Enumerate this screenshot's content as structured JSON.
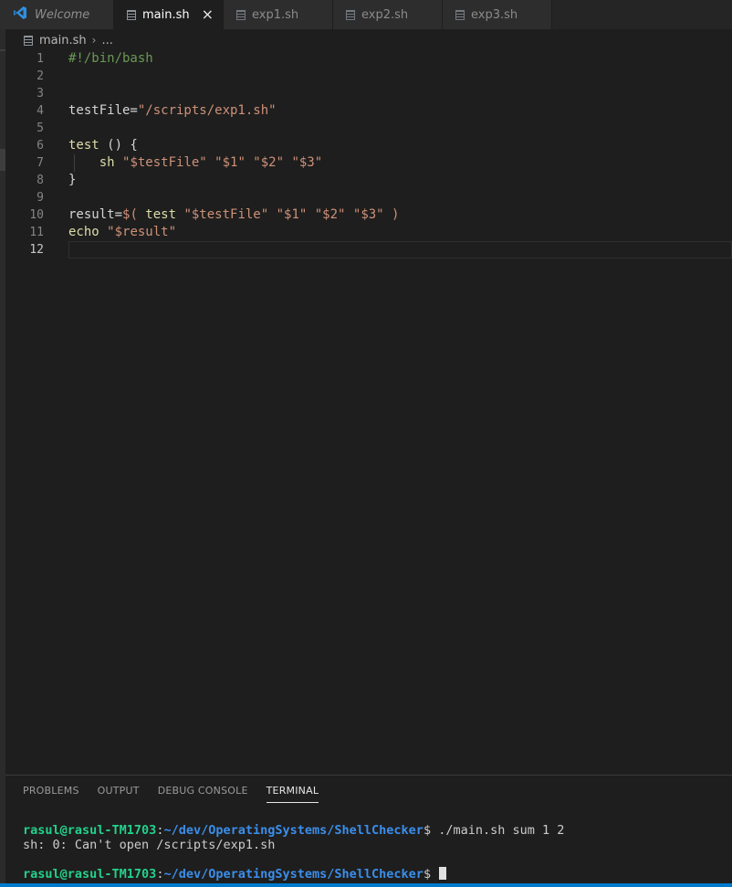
{
  "tabs": [
    {
      "label": "Welcome",
      "icon": "vscode-logo-icon",
      "active": false
    },
    {
      "label": "main.sh",
      "icon": "file-icon",
      "active": true,
      "close": "×"
    },
    {
      "label": "exp1.sh",
      "icon": "file-icon",
      "active": false
    },
    {
      "label": "exp2.sh",
      "icon": "file-icon",
      "active": false
    },
    {
      "label": "exp3.sh",
      "icon": "file-icon",
      "active": false
    }
  ],
  "breadcrumb": {
    "file": "main.sh",
    "separator": "›",
    "more": "..."
  },
  "editor": {
    "current_line": 12,
    "lines": [
      {
        "n": "1",
        "text": "#!/bin/bash"
      },
      {
        "n": "2",
        "text": ""
      },
      {
        "n": "3",
        "text": ""
      },
      {
        "n": "4",
        "text": "testFile=\"/scripts/exp1.sh\""
      },
      {
        "n": "5",
        "text": ""
      },
      {
        "n": "6",
        "text": "test () {"
      },
      {
        "n": "7",
        "text": "    sh \"$testFile\" \"$1\" \"$2\" \"$3\""
      },
      {
        "n": "8",
        "text": "}"
      },
      {
        "n": "9",
        "text": ""
      },
      {
        "n": "10",
        "text": "result=$( test \"$testFile\" \"$1\" \"$2\" \"$3\" )"
      },
      {
        "n": "11",
        "text": "echo \"$result\""
      },
      {
        "n": "12",
        "text": ""
      }
    ],
    "tokens": {
      "l1": "#!/bin/bash",
      "l4a": "testFile=",
      "l4b": "\"/scripts/exp1.sh\"",
      "l6a": "test",
      "l6b": " () {",
      "l7a": "    ",
      "l7b": "sh",
      "l7c": " ",
      "l7d": "\"$testFile\" \"$1\" \"$2\" \"$3\"",
      "l8": "}",
      "l10a": "result=",
      "l10b": "$(",
      "l10c": " test ",
      "l10d": "\"$testFile\" \"$1\" \"$2\" \"$3\"",
      "l10e": " )",
      "l11a": "echo",
      "l11b": " ",
      "l11c": "\"$result\""
    }
  },
  "panel": {
    "tabs": [
      "PROBLEMS",
      "OUTPUT",
      "DEBUG CONSOLE",
      "TERMINAL"
    ],
    "active_tab": "TERMINAL"
  },
  "terminal": {
    "line1": {
      "user": "rasul@rasul-TM1703",
      "colon": ":",
      "path": "~/dev/OperatingSystems/ShellChecker",
      "prompt": "$ ",
      "cmd": "./main.sh sum 1 2"
    },
    "line2": "sh: 0: Can't open /scripts/exp1.sh",
    "line3": {
      "user": "rasul@rasul-TM1703",
      "colon": ":",
      "path": "~/dev/OperatingSystems/ShellChecker",
      "prompt": "$ "
    }
  },
  "colors": {
    "accent": "#007acc",
    "string": "#ce9178",
    "comment": "#6a9955",
    "function": "#dcdcaa",
    "terminal_user": "#23d18b",
    "terminal_path": "#3b8eea"
  }
}
